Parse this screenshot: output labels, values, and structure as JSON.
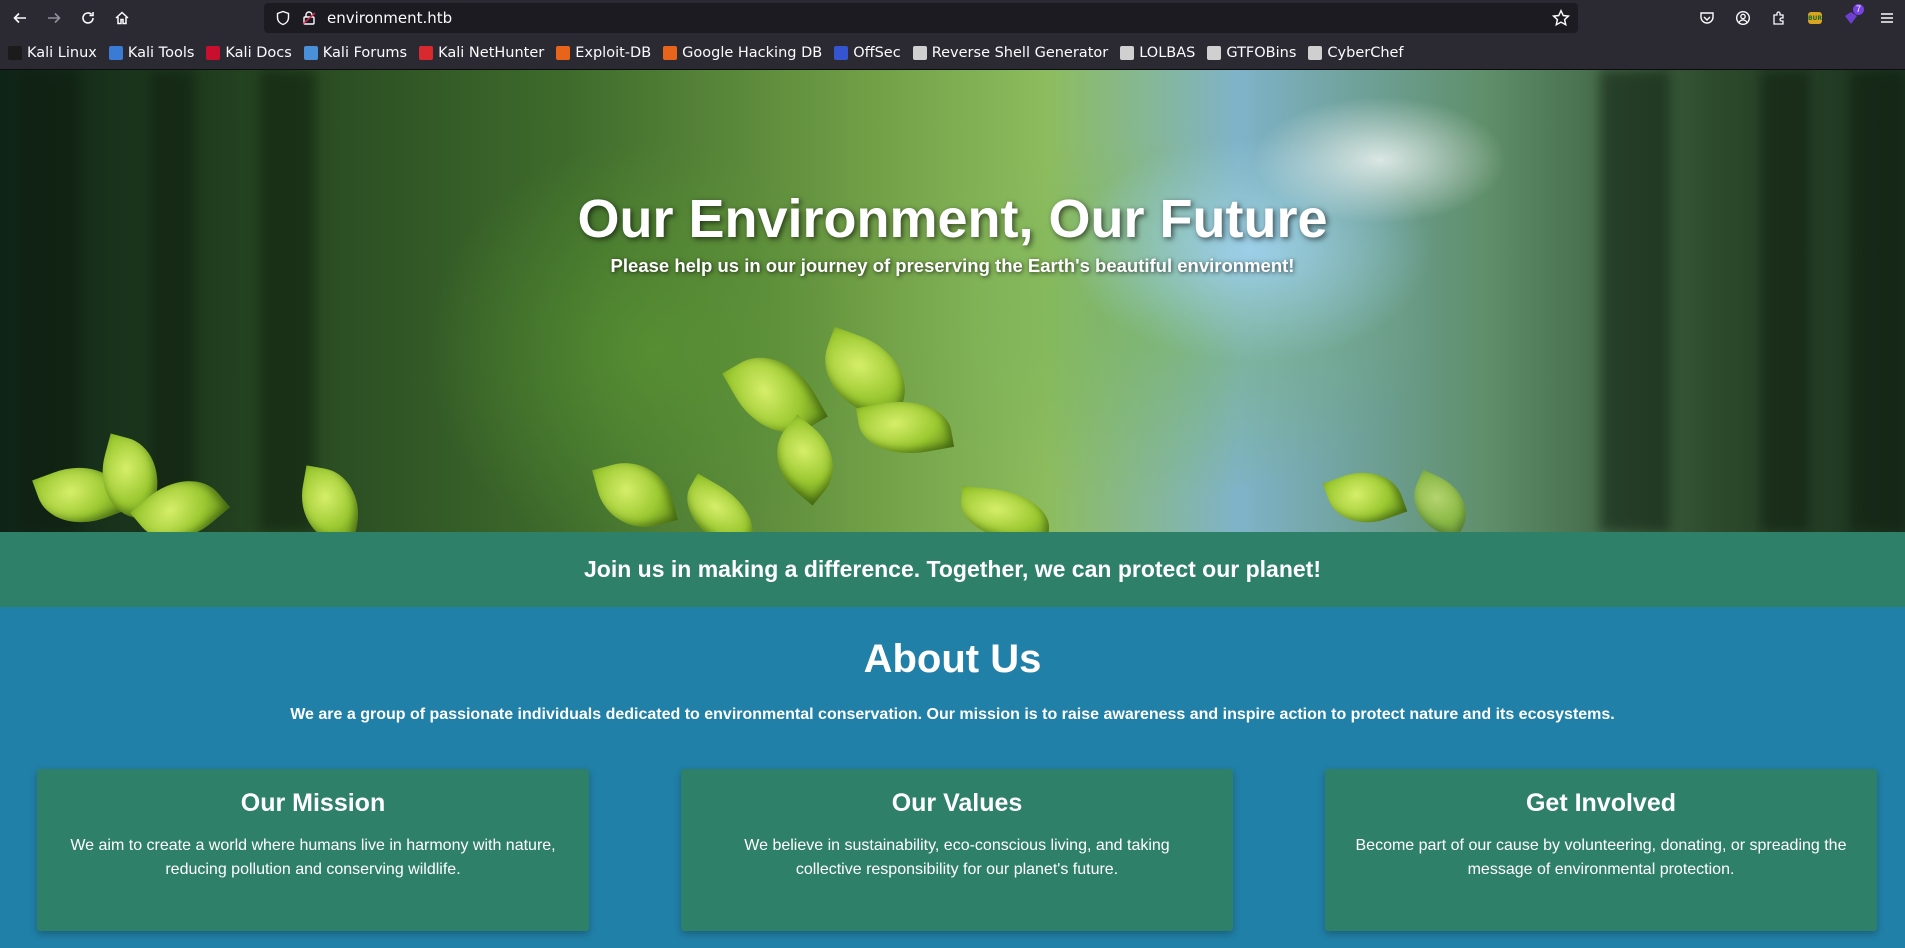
{
  "browser": {
    "url": "environment.htb",
    "bookmarks": [
      {
        "label": "Kali Linux",
        "icon_color": "#1b1b1b"
      },
      {
        "label": "Kali Tools",
        "icon_color": "#3a7bd5"
      },
      {
        "label": "Kali Docs",
        "icon_color": "#c8102e"
      },
      {
        "label": "Kali Forums",
        "icon_color": "#4a90d9"
      },
      {
        "label": "Kali NetHunter",
        "icon_color": "#d8292f"
      },
      {
        "label": "Exploit-DB",
        "icon_color": "#e8641b"
      },
      {
        "label": "Google Hacking DB",
        "icon_color": "#e8641b"
      },
      {
        "label": "OffSec",
        "icon_color": "#3454d1"
      },
      {
        "label": "Reverse Shell Generator",
        "icon_color": "#d0d0d0"
      },
      {
        "label": "LOLBAS",
        "icon_color": "#d0d0d0"
      },
      {
        "label": "GTFOBins",
        "icon_color": "#d0d0d0"
      },
      {
        "label": "CyberChef",
        "icon_color": "#cfcfcf"
      }
    ],
    "extension_badge": "7"
  },
  "hero": {
    "title": "Our Environment, Our Future",
    "subtitle": "Please help us in our journey of preserving the Earth's beautiful environment!"
  },
  "banner": {
    "text": "Join us in making a difference. Together, we can protect our planet!"
  },
  "about": {
    "title": "About Us",
    "text": "We are a group of passionate individuals dedicated to environmental conservation. Our mission is to raise awareness and inspire action to protect nature and its ecosystems.",
    "cards": [
      {
        "title": "Our Mission",
        "text": "We aim to create a world where humans live in harmony with nature, reducing pollution and conserving wildlife."
      },
      {
        "title": "Our Values",
        "text": "We believe in sustainability, eco-conscious living, and taking collective responsibility for our planet's future."
      },
      {
        "title": "Get Involved",
        "text": "Become part of our cause by volunteering, donating, or spreading the message of environmental protection."
      }
    ]
  },
  "colors": {
    "banner": "#2f8068",
    "about_bg": "#2180a8",
    "card_bg": "#2f8068"
  }
}
